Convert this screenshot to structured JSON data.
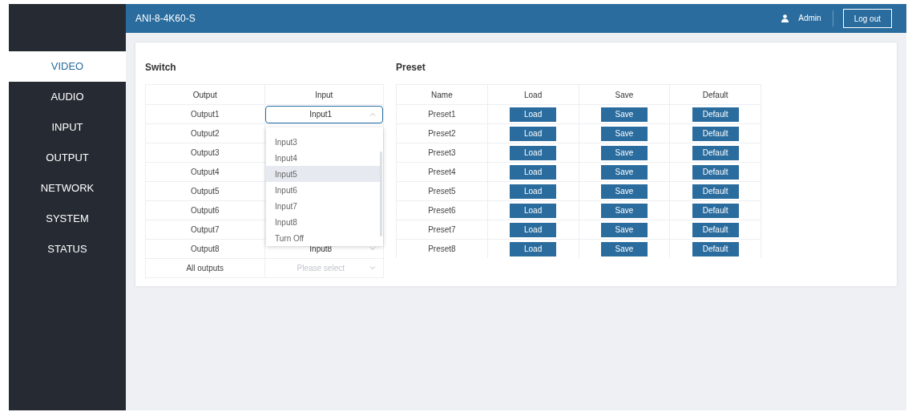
{
  "header": {
    "title": "ANI-8-4K60-S",
    "user": "Admin",
    "logout": "Log out"
  },
  "sidebar": {
    "items": [
      {
        "label": "VIDEO",
        "selected": true
      },
      {
        "label": "AUDIO",
        "selected": false
      },
      {
        "label": "INPUT",
        "selected": false
      },
      {
        "label": "OUTPUT",
        "selected": false
      },
      {
        "label": "NETWORK",
        "selected": false
      },
      {
        "label": "SYSTEM",
        "selected": false
      },
      {
        "label": "STATUS",
        "selected": false
      }
    ]
  },
  "switch": {
    "title": "Switch",
    "columns": [
      "Output",
      "Input"
    ],
    "rows": [
      {
        "output": "Output1",
        "input": "Input1",
        "expanded": true,
        "options": [
          {
            "label": "Input3",
            "selected": false
          },
          {
            "label": "Input4",
            "selected": false
          },
          {
            "label": "Input5",
            "selected": true
          },
          {
            "label": "Input6",
            "selected": false
          },
          {
            "label": "Input7",
            "selected": false
          },
          {
            "label": "Input8",
            "selected": false
          },
          {
            "label": "Turn Off",
            "selected": false
          }
        ]
      },
      {
        "output": "Output2"
      },
      {
        "output": "Output3"
      },
      {
        "output": "Output4"
      },
      {
        "output": "Output5"
      },
      {
        "output": "Output6"
      },
      {
        "output": "Output7"
      },
      {
        "output": "Output8",
        "input": "Input8",
        "expanded": false
      }
    ],
    "all": {
      "output": "All outputs",
      "placeholder": "Please select"
    }
  },
  "preset": {
    "title": "Preset",
    "columns": [
      "Name",
      "Load",
      "Save",
      "Default"
    ],
    "rows": [
      {
        "name": "Preset1",
        "load": "Load",
        "save": "Save",
        "default": "Default"
      },
      {
        "name": "Preset2",
        "load": "Load",
        "save": "Save",
        "default": "Default"
      },
      {
        "name": "Preset3",
        "load": "Load",
        "save": "Save",
        "default": "Default"
      },
      {
        "name": "Preset4",
        "load": "Load",
        "save": "Save",
        "default": "Default"
      },
      {
        "name": "Preset5",
        "load": "Load",
        "save": "Save",
        "default": "Default"
      },
      {
        "name": "Preset6",
        "load": "Load",
        "save": "Save",
        "default": "Default"
      },
      {
        "name": "Preset7",
        "load": "Load",
        "save": "Save",
        "default": "Default"
      },
      {
        "name": "Preset8",
        "load": "Load",
        "save": "Save",
        "default": "Default"
      }
    ]
  }
}
